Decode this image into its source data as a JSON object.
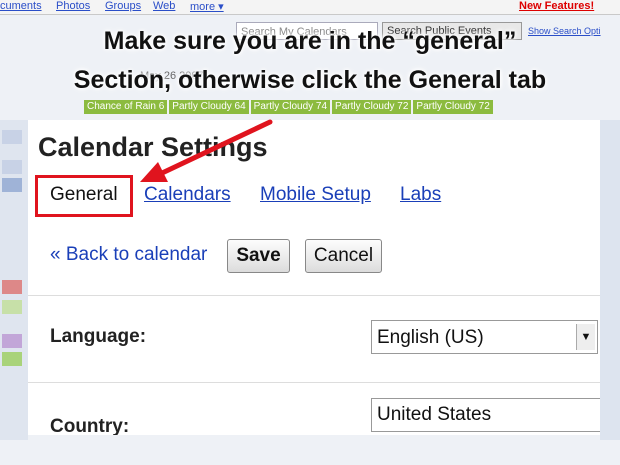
{
  "background": {
    "topnav": [
      "cuments",
      "Photos",
      "Groups",
      "Web",
      "more ▾"
    ],
    "new_features": "New Features!",
    "search_my_calendars": "Search My Calendars",
    "search_public_events": "Search Public Events",
    "show_search_options": "Show Search Opti",
    "date_fragment": "May 26 2007",
    "weather": [
      "Chance of Rain 6",
      "Partly Cloudy 64",
      "Partly Cloudy 74",
      "Partly Cloudy 72",
      "Partly Cloudy 72"
    ]
  },
  "overlay": {
    "line1": "Make sure you are in the “general”",
    "line2": "Section, otherwise click the General tab",
    "accent_color": "#e0141e"
  },
  "settings": {
    "title": "Calendar Settings",
    "tabs": [
      {
        "label": "General",
        "active": true
      },
      {
        "label": "Calendars",
        "active": false
      },
      {
        "label": "Mobile Setup",
        "active": false
      },
      {
        "label": "Labs",
        "active": false
      }
    ],
    "back_link": "« Back to calendar",
    "save_label": "Save",
    "cancel_label": "Cancel",
    "language_label": "Language:",
    "language_value": "English (US)",
    "country_label": "Country:",
    "country_value": "United States",
    "link_color": "#1a3fb8"
  }
}
